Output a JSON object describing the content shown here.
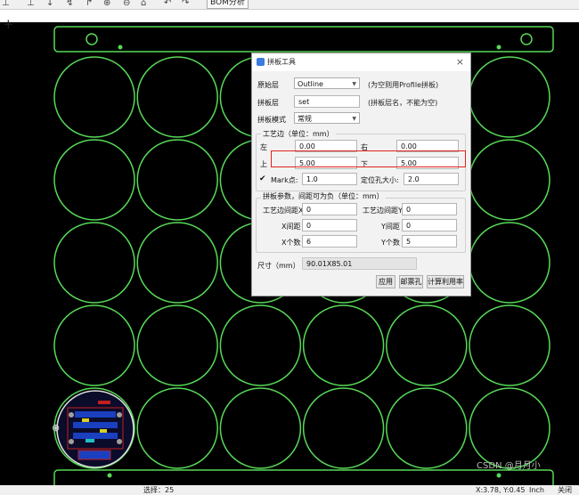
{
  "toolbar": {
    "icons": [
      "align-left-icon",
      "align-bottom-icon",
      "align-right-icon",
      "flip-icon",
      "zoom-in-icon",
      "zoom-out-icon",
      "home-icon",
      "undo-icon",
      "redo-icon"
    ],
    "bom_label": "BOM分析"
  },
  "add_symbol": "+",
  "dialog": {
    "title": "拼板工具",
    "close_symbol": "×",
    "source_layer": {
      "label": "原始层",
      "value": "Outline",
      "hint": "(为空则用Profile拼板)"
    },
    "panel_layer": {
      "label": "拼板层",
      "value": "set",
      "hint": "(拼板层名，不能为空)"
    },
    "panel_mode": {
      "label": "拼板模式",
      "value": "常规"
    },
    "process_edge": {
      "title": "工艺边（单位：mm）",
      "left_label": "左",
      "left_value": "0.00",
      "right_label": "右",
      "right_value": "0.00",
      "top_label": "上",
      "top_value": "5.00",
      "bottom_label": "下",
      "bottom_value": "5.00",
      "mark_checked": true,
      "mark_label": "Mark点:",
      "mark_value": "1.0",
      "hole_label": "定位孔大小:",
      "hole_value": "2.0"
    },
    "panel_params": {
      "title": "拼板参数，间距可为负（单位：mm）",
      "edge_gap_x_label": "工艺边间距X",
      "edge_gap_x_value": "0",
      "edge_gap_y_label": "工艺边间距Y",
      "edge_gap_y_value": "0",
      "x_gap_label": "X间距",
      "x_gap_value": "0",
      "y_gap_label": "Y间距",
      "y_gap_value": "0",
      "x_count_label": "X个数",
      "x_count_value": "6",
      "y_count_label": "Y个数",
      "y_count_value": "5"
    },
    "size_label": "尺寸（mm）",
    "size_value": "90.01X85.01",
    "buttons": {
      "apply": "应用",
      "stamp_hole": "邮票孔",
      "calc_rate": "计算利用率"
    }
  },
  "statusbar": {
    "selection": "选择：25",
    "coords": "X:3.78, Y:0.45",
    "unit": "Inch",
    "close": "关闭"
  },
  "watermark": "CSDN @月月小",
  "colors": {
    "outline": "#57d957",
    "highlight": "#e0221c",
    "canvas": "#000000"
  }
}
